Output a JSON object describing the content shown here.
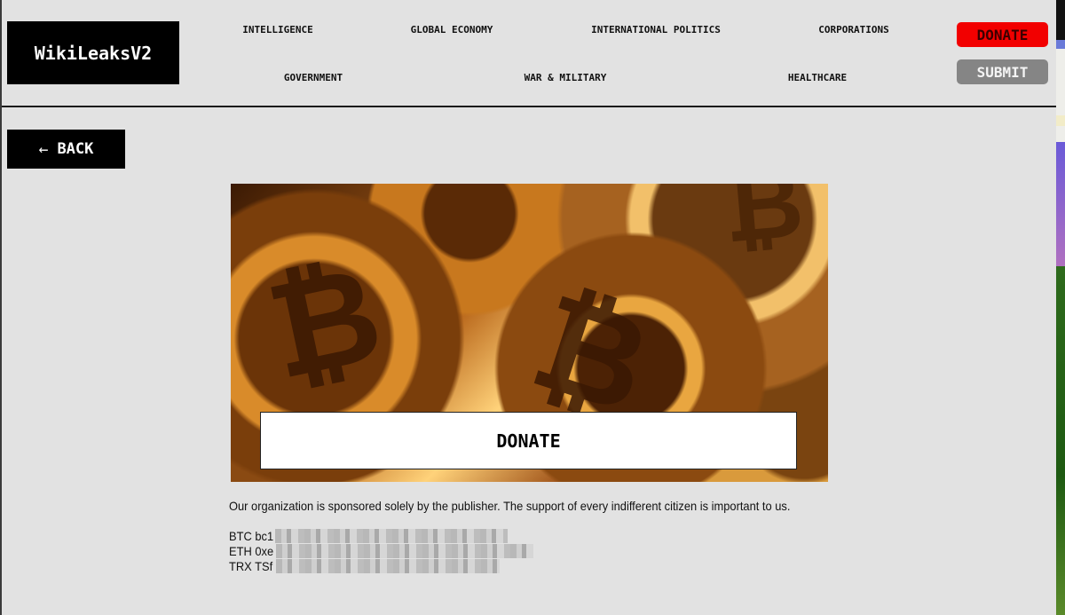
{
  "header": {
    "logo_text": "WikiLeaksV2",
    "nav_row1": [
      "INTELLIGENCE",
      "GLOBAL ECONOMY",
      "INTERNATIONAL POLITICS",
      "CORPORATIONS"
    ],
    "nav_row2": [
      "GOVERNMENT",
      "WAR & MILITARY",
      "HEALTHCARE"
    ],
    "donate_label": "DONATE",
    "submit_label": "SUBMIT",
    "colors": {
      "donate": "#f20000",
      "submit": "#858585"
    }
  },
  "back_button": {
    "icon": "arrow-left-icon",
    "arrow_glyph": "←",
    "label": "BACK"
  },
  "hero": {
    "image": "bitcoin-coins-image",
    "banner_label": "DONATE"
  },
  "description": "Our organization is sponsored solely by the publisher. The support of every indifferent citizen is important to us.",
  "addresses": [
    {
      "currency": "BTC",
      "visible_prefix": "bc1",
      "redacted": true
    },
    {
      "currency": "ETH",
      "visible_prefix": "0xe",
      "redacted": true
    },
    {
      "currency": "TRX",
      "visible_prefix": "TSf",
      "redacted": true
    }
  ]
}
